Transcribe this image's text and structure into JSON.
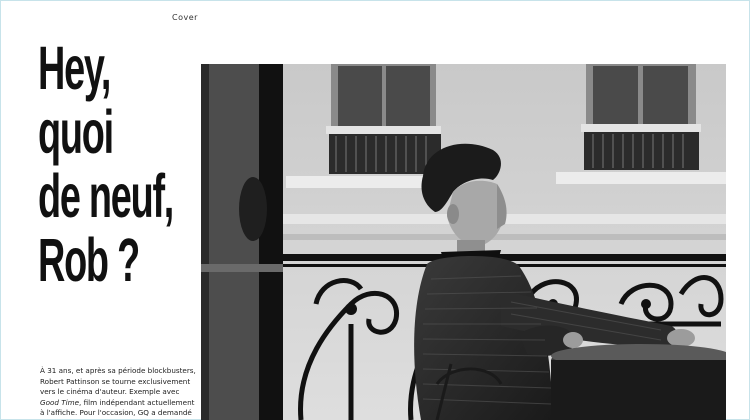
{
  "section_label": "Cover",
  "headline": {
    "line1": "Hey,",
    "line2": "quoi",
    "line3": "de neuf,",
    "line4": "Rob ?"
  },
  "intro": {
    "l1": "À 31 ans, et après sa période blockbusters,",
    "l2": "Robert Pattinson se tourne exclusivement",
    "l3": "vers le cinéma d'auteur. Exemple avec",
    "l4_em": "Good Time",
    "l4_rest": ", film indépendant actuellement",
    "l5": "à l'affiche. Pour l'occasion, GQ a demandé"
  },
  "photo": {
    "subject": "man-seated-on-balcony",
    "tone": "black-and-white"
  },
  "colors": {
    "frame_border": "#c7e3ea",
    "text": "#111111",
    "photo_dark": "#1c1c1c",
    "photo_light": "#d9d9d9"
  }
}
